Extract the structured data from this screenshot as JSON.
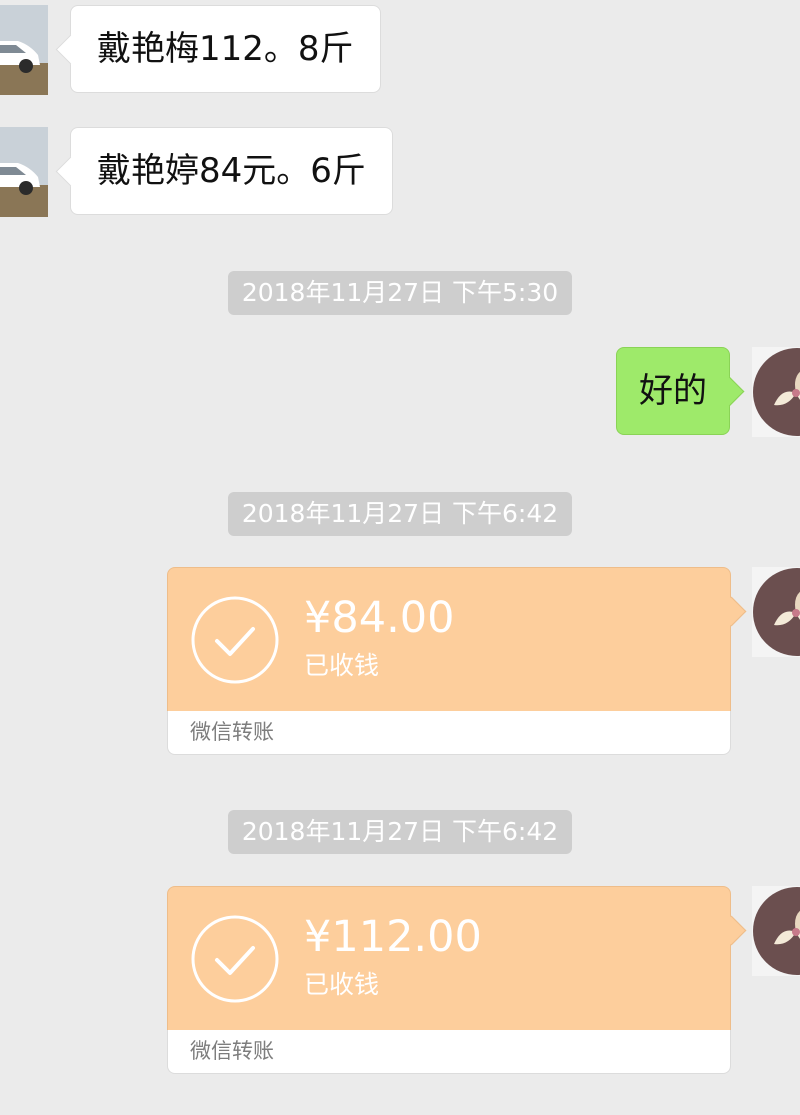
{
  "messages": {
    "msg1": {
      "text": "戴艳梅112。8斤"
    },
    "msg2": {
      "text": "戴艳婷84元。6斤"
    },
    "time1": "2018年11月27日 下午5:30",
    "reply": {
      "text": "好的"
    },
    "time2": "2018年11月27日 下午6:42",
    "transfer1": {
      "amount": "¥84.00",
      "status": "已收钱",
      "label": "微信转账"
    },
    "time3": "2018年11月27日 下午6:42",
    "transfer2": {
      "amount": "¥112.00",
      "status": "已收钱",
      "label": "微信转账"
    }
  },
  "colors": {
    "background": "#ebebeb",
    "sent_bubble": "#9eea6a",
    "transfer_card": "#fdce9c",
    "timestamp_bg": "#cecece"
  },
  "icons": {
    "other_avatar": "car-photo-avatar",
    "self_avatar": "flower-avatar",
    "transfer_status": "check-circle-icon"
  }
}
